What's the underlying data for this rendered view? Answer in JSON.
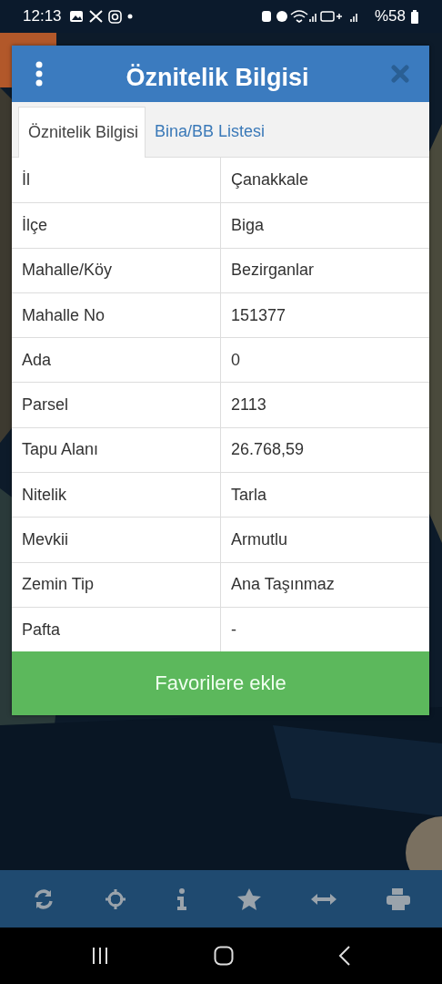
{
  "status_bar": {
    "time": "12:13",
    "battery": "%58"
  },
  "dialog": {
    "title": "Öznitelik Bilgisi",
    "tabs": [
      {
        "label": "Öznitelik Bilgisi",
        "selected": true
      },
      {
        "label": "Bina/BB Listesi",
        "selected": false
      }
    ],
    "rows": [
      {
        "label": "İl",
        "value": "Çanakkale"
      },
      {
        "label": "İlçe",
        "value": "Biga"
      },
      {
        "label": "Mahalle/Köy",
        "value": "Bezirganlar"
      },
      {
        "label": "Mahalle No",
        "value": "151377"
      },
      {
        "label": "Ada",
        "value": "0"
      },
      {
        "label": "Parsel",
        "value": "2113"
      },
      {
        "label": "Tapu Alanı",
        "value": "26.768,59"
      },
      {
        "label": "Nitelik",
        "value": "Tarla"
      },
      {
        "label": "Mevkii",
        "value": "Armutlu"
      },
      {
        "label": "Zemin Tip",
        "value": "Ana Taşınmaz"
      },
      {
        "label": "Pafta",
        "value": "-"
      }
    ],
    "button": "Favorilere ekle"
  }
}
